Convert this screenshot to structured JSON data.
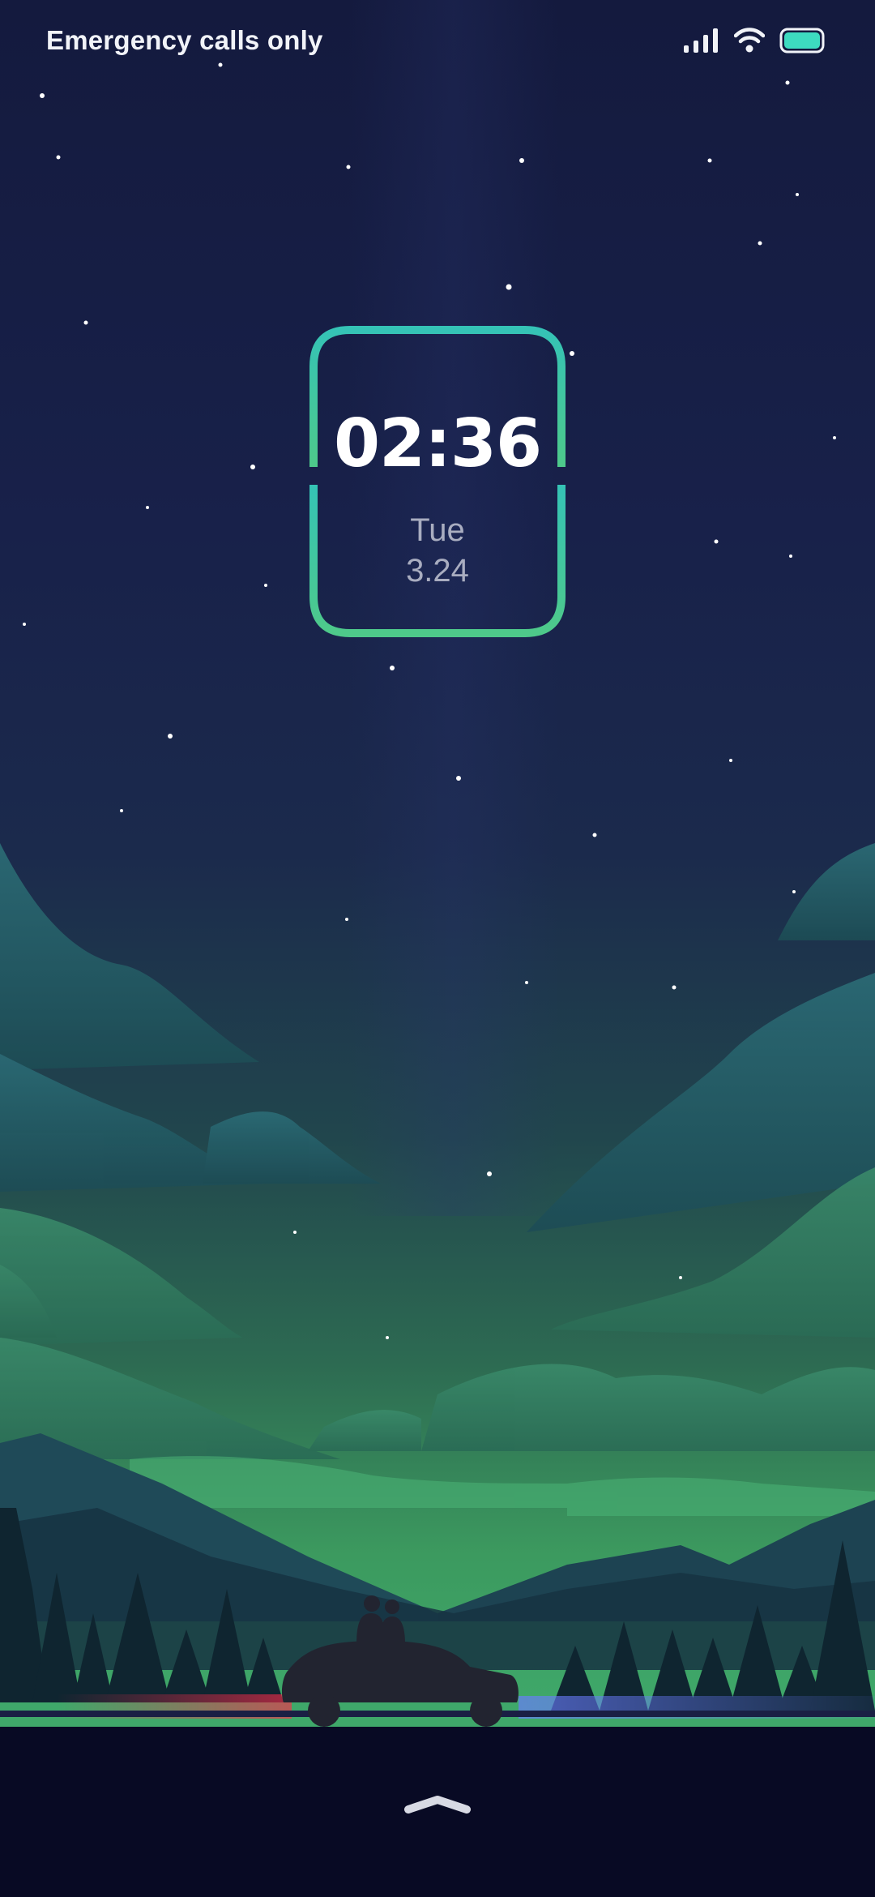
{
  "status_bar": {
    "carrier_text": "Emergency calls only",
    "icons": [
      "signal-icon",
      "wifi-icon",
      "battery-icon"
    ]
  },
  "clock": {
    "time": "02:36",
    "day": "Tue",
    "date": "3.24",
    "frame_color_top": "#35c3b6",
    "frame_color_bottom": "#4ec98a"
  },
  "unlock": {
    "icon": "chevron-up-icon"
  },
  "colors": {
    "battery": "#3ddbc0",
    "sky_top": "#141a3e",
    "sky_glow": "#3fa86a",
    "ground": "#080a24"
  }
}
